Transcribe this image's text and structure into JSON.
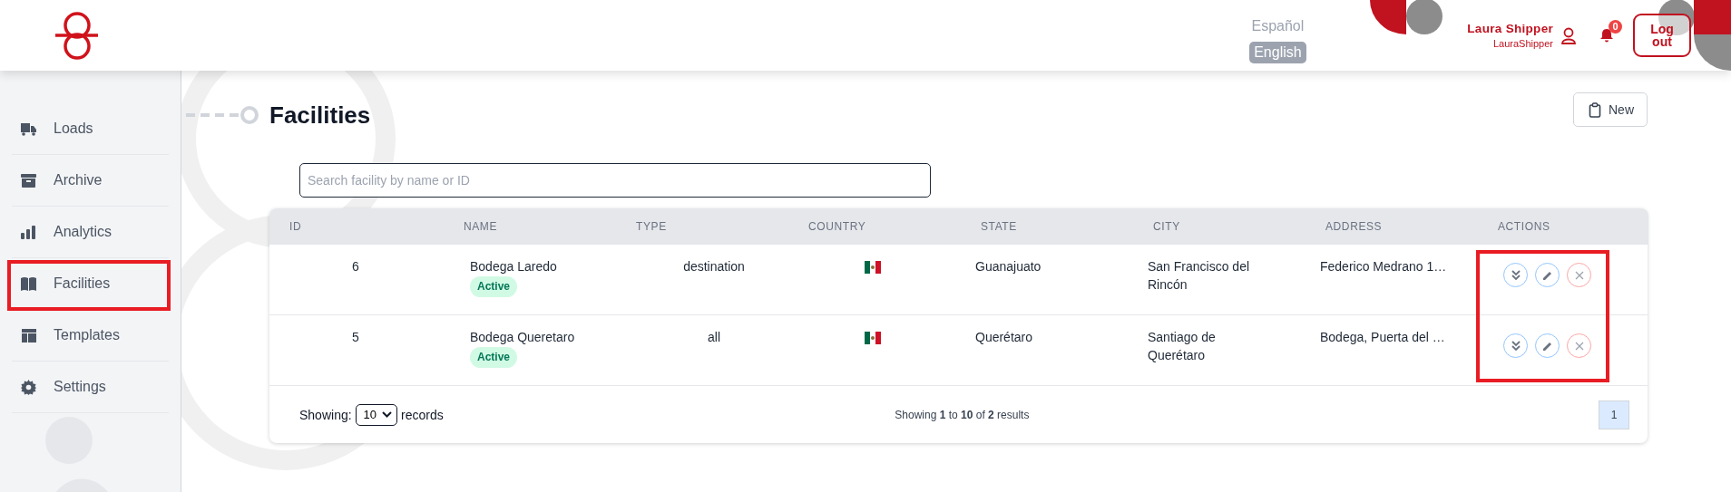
{
  "header": {
    "languages": [
      {
        "label": "Español",
        "selected": false
      },
      {
        "label": "English",
        "selected": true
      }
    ],
    "user": {
      "name": "Laura Shipper",
      "username": "LauraShipper"
    },
    "notifications": {
      "count": "0"
    },
    "logout": "Log out"
  },
  "sidebar": {
    "items": [
      {
        "label": "Loads",
        "highlighted": false
      },
      {
        "label": "Archive",
        "highlighted": false
      },
      {
        "label": "Analytics",
        "highlighted": false
      },
      {
        "label": "Facilities",
        "highlighted": true
      },
      {
        "label": "Templates",
        "highlighted": false
      },
      {
        "label": "Settings",
        "highlighted": false
      }
    ]
  },
  "page": {
    "title": "Facilities",
    "new_button": "New"
  },
  "search": {
    "placeholder": "Search facility by name or ID"
  },
  "table": {
    "columns": [
      "ID",
      "NAME",
      "TYPE",
      "COUNTRY",
      "STATE",
      "CITY",
      "ADDRESS",
      "ACTIONS"
    ],
    "actions_highlighted": true,
    "rows": [
      {
        "id": "6",
        "name": "Bodega Laredo",
        "status": "Active",
        "type": "destination",
        "state": "Guanajuato",
        "city": "San Francisco del Rincón",
        "address": "Federico Medrano 1…"
      },
      {
        "id": "5",
        "name": "Bodega Queretaro",
        "status": "Active",
        "type": "all",
        "state": "Querétaro",
        "city": "Santiago de Querétaro",
        "address": "Bodega, Puerta del …"
      }
    ]
  },
  "footer": {
    "showing_label": "Showing:",
    "page_size": "10",
    "records_label": "records",
    "summary": "Showing **1** to **10** of **2** results",
    "pages": [
      {
        "label": "1",
        "selected": true
      }
    ]
  }
}
